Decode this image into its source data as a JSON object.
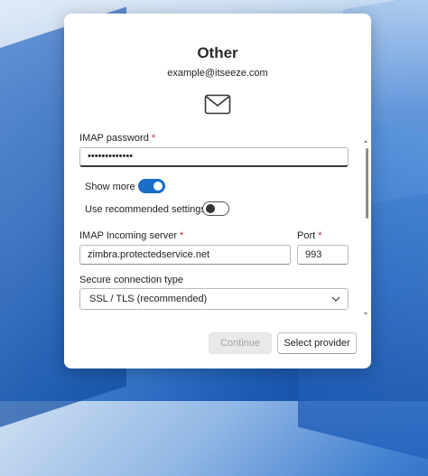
{
  "dialog": {
    "title": "Other",
    "email": "example@itseeze.com",
    "icon": "mail-icon"
  },
  "password": {
    "label": "IMAP password",
    "required_mark": "*",
    "value": "•••••••••••••"
  },
  "toggles": {
    "show_more": {
      "label": "Show more",
      "state": true
    },
    "use_recommended": {
      "label": "Use recommended settings",
      "state": false
    }
  },
  "server": {
    "label": "IMAP Incoming server",
    "required_mark": "*",
    "value": "zimbra.protectedservice.net"
  },
  "port": {
    "label": "Port",
    "required_mark": "*",
    "value": "993"
  },
  "secure": {
    "label": "Secure connection type",
    "selected": "SSL / TLS (recommended)"
  },
  "buttons": {
    "continue_label": "Continue",
    "select_provider_label": "Select provider"
  },
  "colors": {
    "accent": "#1a6ec8",
    "required": "#c4262e"
  }
}
